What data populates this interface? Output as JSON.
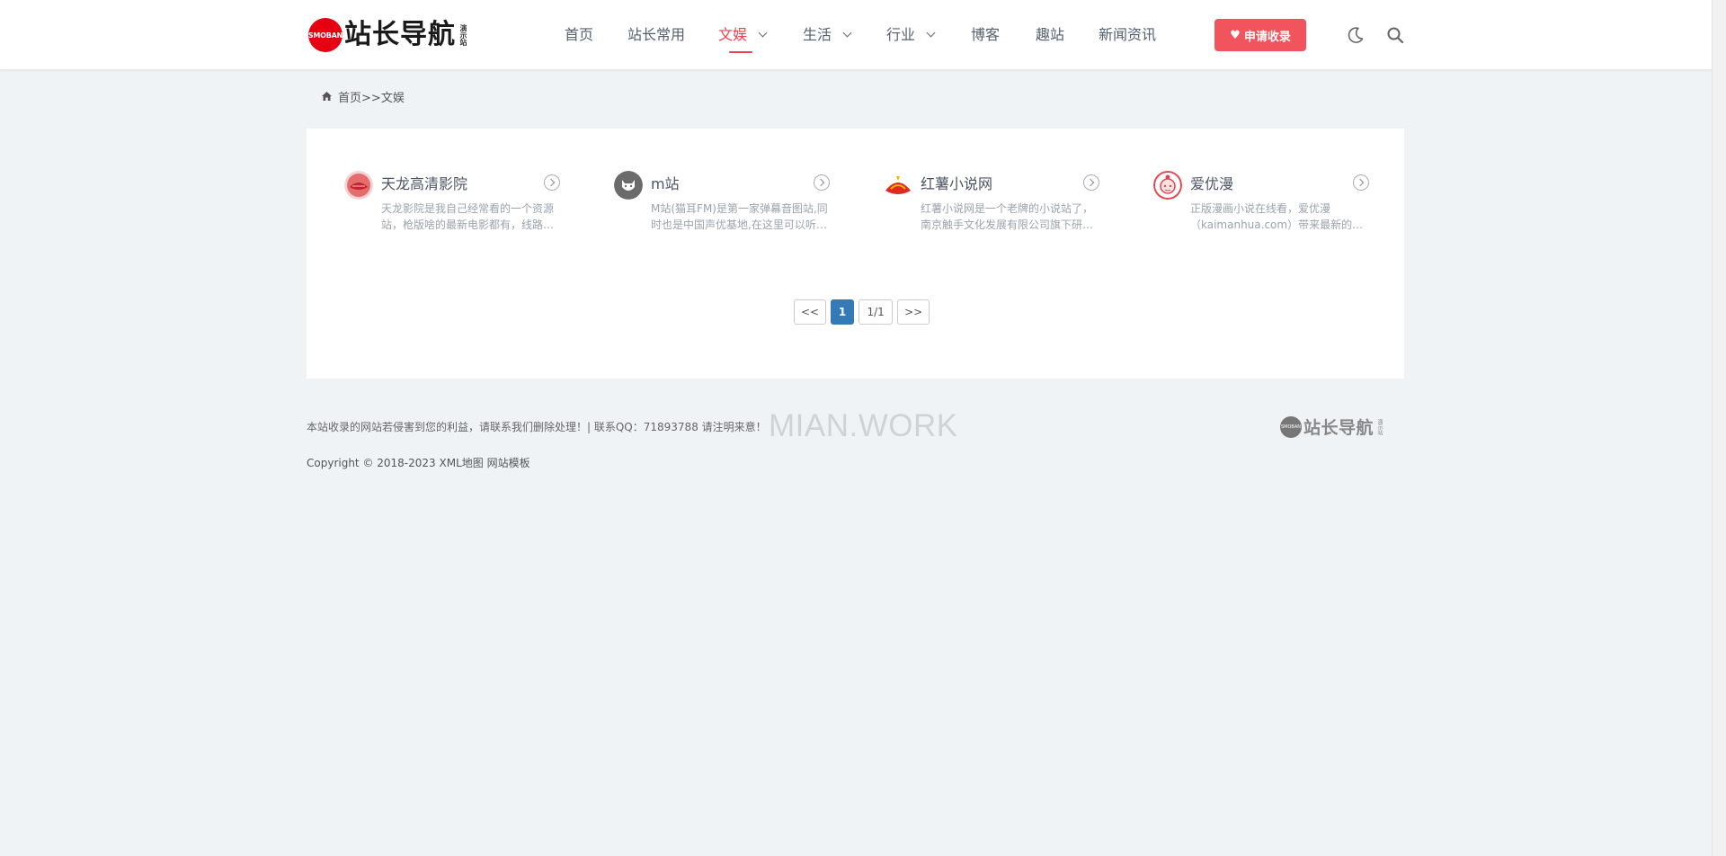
{
  "header": {
    "logo": {
      "badge": "SMOBAN",
      "title": "站长导航",
      "subtitle": "演示站"
    },
    "nav": [
      {
        "label": "首页",
        "dropdown": false,
        "active": false
      },
      {
        "label": "站长常用",
        "dropdown": false,
        "active": false
      },
      {
        "label": "文娱",
        "dropdown": true,
        "active": true
      },
      {
        "label": "生活",
        "dropdown": true,
        "active": false
      },
      {
        "label": "行业",
        "dropdown": true,
        "active": false
      },
      {
        "label": "博客",
        "dropdown": false,
        "active": false
      },
      {
        "label": "趣站",
        "dropdown": false,
        "active": false
      },
      {
        "label": "新闻资讯",
        "dropdown": false,
        "active": false
      }
    ],
    "apply_button": "申请收录",
    "icons": [
      "moon-icon",
      "search-icon"
    ]
  },
  "breadcrumb": {
    "home": "首页",
    "separator": ">>",
    "current": "文娱"
  },
  "cards": [
    {
      "title": "天龙高清影院",
      "desc": "天龙影院是我自己经常看的一个资源站，枪版啥的最新电影都有，线路很多，速度也快。",
      "icon": "tianlong-logo"
    },
    {
      "title": "m站",
      "desc": "M站(猫耳FM)是第一家弹幕音图站,同时也是中国声优基地,在这里可以听电台、音乐、小说、漫画等。",
      "icon": "cat-logo"
    },
    {
      "title": "红薯小说网",
      "desc": "红薯小说网是一个老牌的小说站了，南京触手文化发展有限公司旗下研发的小说阅读网站。",
      "icon": "hongshu-logo"
    },
    {
      "title": "爱优漫",
      "desc": "正版漫画小说在线看，爱优漫（kaimanhua.com）带来最新的漫画小说作品。",
      "icon": "aiyouman-logo"
    }
  ],
  "pagination": {
    "prev": "<<",
    "current": "1",
    "info": "1/1",
    "next": ">>"
  },
  "footer": {
    "notice": "本站收录的网站若侵害到您的利益，请联系我们删除处理！| 联系QQ：71893788 请注明来意！",
    "watermark": "MIAN.WORK",
    "logo_title": "站长导航",
    "logo_badge": "SMOBAN",
    "logo_sub": "演示站",
    "copyright": "Copyright © 2018-2023",
    "links": [
      "XML地图",
      "网站模板"
    ]
  },
  "colors": {
    "accent": "#f1404b",
    "apply_button": "#f1545c",
    "pager_active": "#337ab7",
    "background": "#f0f3f6"
  }
}
